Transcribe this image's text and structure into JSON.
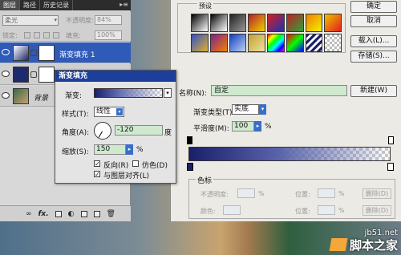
{
  "layers_panel": {
    "tabs": [
      "图层",
      "路径",
      "历史记录"
    ],
    "blend_mode": "柔光",
    "opacity_label": "不透明度:",
    "opacity_value": "84%",
    "lock_label": "锁定:",
    "fill_label": "填充:",
    "fill_value": "100%",
    "layers": [
      {
        "name": "渐变填充 1",
        "selected": true
      },
      {
        "name": "",
        "selected": false
      },
      {
        "name": "背景",
        "selected": false
      }
    ],
    "bottom_fx": "fx."
  },
  "gradient_fill_dialog": {
    "title": "渐变填充",
    "gradient_label": "渐变:",
    "style_label": "样式(T):",
    "style_value": "线性",
    "angle_label": "角度(A):",
    "angle_value": "-120",
    "angle_unit": "度",
    "scale_label": "缩放(S):",
    "scale_value": "150",
    "scale_unit": "%",
    "reverse_label": "反向(R)",
    "reverse_checked": true,
    "dither_label": "仿色(D)",
    "dither_checked": false,
    "align_label": "与图层对齐(L)",
    "align_checked": true
  },
  "gradient_editor": {
    "presets_label": "预设",
    "buttons": {
      "ok": "确定",
      "cancel": "取消",
      "load": "载入(L)...",
      "save": "存储(S)...",
      "new": "新建(W)"
    },
    "name_label": "名称(N):",
    "name_value": "自定",
    "gradient_type_label": "渐变类型(T):",
    "gradient_type_value": "实底",
    "smoothness_label": "平滑度(M):",
    "smoothness_value": "100",
    "smoothness_unit": "%",
    "stops_label": "色标",
    "opacity_label": "不透明度:",
    "opacity_unit": "%",
    "location_label": "位置:",
    "location_unit": "%",
    "delete_label": "删除(D)",
    "color_label": "颜色:",
    "location2_label": "位置:",
    "location2_unit": "%",
    "delete2_label": "删除(D)"
  },
  "watermark": {
    "site": "jb51.net",
    "brand": "脚本之家"
  },
  "colors": {
    "dialog_title": "#1c3f9c",
    "selected_layer": "#2f5ab8",
    "input_green": "#cfe9cf",
    "gradient_dark": "#1a1f6a"
  }
}
